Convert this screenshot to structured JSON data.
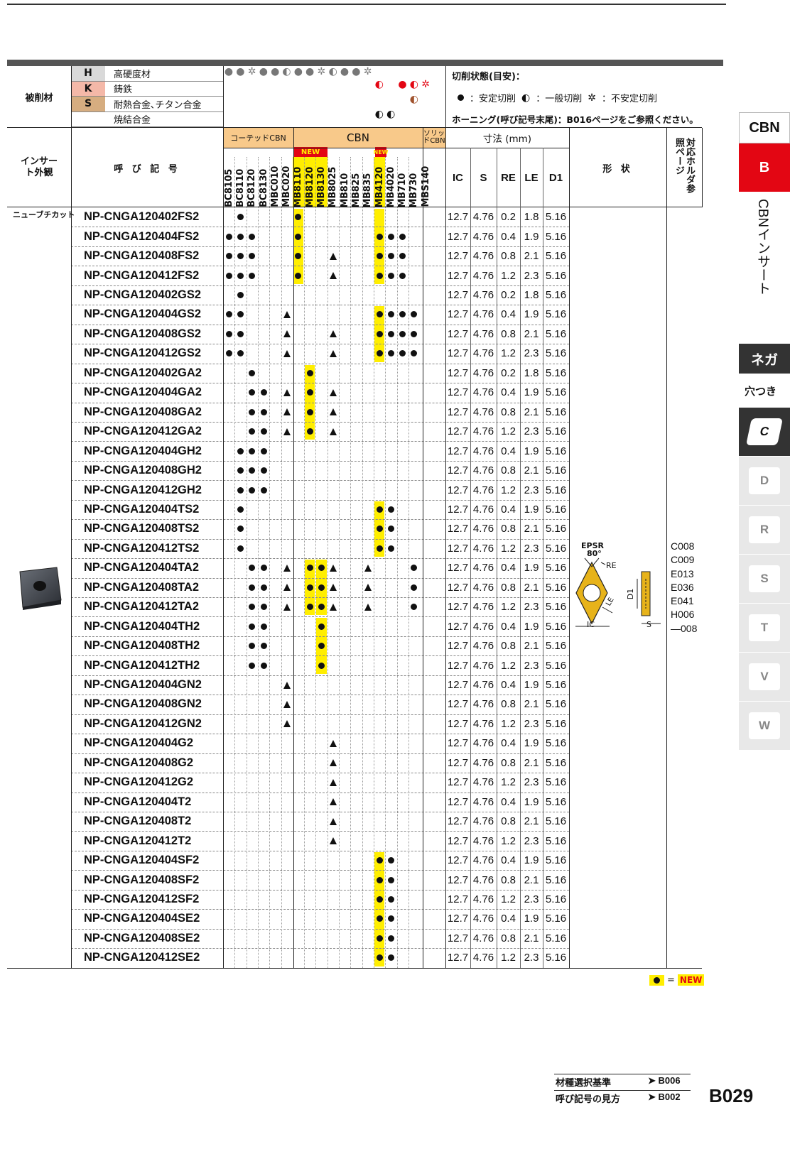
{
  "workpiece": {
    "label": "被削材",
    "rows": [
      {
        "code": "H",
        "name": "高硬度材",
        "color": "#d9d9d9"
      },
      {
        "code": "K",
        "name": "鋳鉄",
        "color": "#f4b8a8"
      },
      {
        "code": "S",
        "name": "耐熱合金､チタン合金",
        "color": "#d6ad80"
      },
      {
        "code": "",
        "name": "焼結合金",
        "color": "#ffffff"
      }
    ]
  },
  "cutting_state": {
    "title": "切削状態(目安)：",
    "stable": "：安定切削",
    "general": "：一般切削",
    "unstable": "：不安定切削",
    "honing": "ホーニング(呼び記号末尾)：B016ページをご参照ください。"
  },
  "header": {
    "insert_appearance": "インサート外観",
    "designation": "呼 び 記 号",
    "coated_cbn": "コーテッドCBN",
    "cbn": "CBN",
    "solid_cbn": "ソリッドCBN",
    "new": "NEW",
    "dimensions": "寸法 (mm)",
    "shape": "形 状",
    "holder_ref": "対応ホルダ参照ページ",
    "dim_cols": [
      "IC",
      "S",
      "RE",
      "LE",
      "D1"
    ]
  },
  "grades": [
    "BC8105",
    "BC8110",
    "BC8120",
    "BC8130",
    "MBC010",
    "MBC020",
    "MB8110",
    "MB8120",
    "MB8130",
    "MB8025",
    "MB810",
    "MB825",
    "MB835",
    "MB4120",
    "MB4020",
    "MB710",
    "MB730",
    "MBS140"
  ],
  "section_label": "ニューブチカット",
  "rows": [
    {
      "code": "NP-CNGA120402FS2",
      "ic": "12.7",
      "s": "4.76",
      "re": "0.2",
      "le": "1.8",
      "d1": "5.16"
    },
    {
      "code": "NP-CNGA120404FS2",
      "ic": "12.7",
      "s": "4.76",
      "re": "0.4",
      "le": "1.9",
      "d1": "5.16"
    },
    {
      "code": "NP-CNGA120408FS2",
      "ic": "12.7",
      "s": "4.76",
      "re": "0.8",
      "le": "2.1",
      "d1": "5.16"
    },
    {
      "code": "NP-CNGA120412FS2",
      "ic": "12.7",
      "s": "4.76",
      "re": "1.2",
      "le": "2.3",
      "d1": "5.16"
    },
    {
      "code": "NP-CNGA120402GS2",
      "ic": "12.7",
      "s": "4.76",
      "re": "0.2",
      "le": "1.8",
      "d1": "5.16"
    },
    {
      "code": "NP-CNGA120404GS2",
      "ic": "12.7",
      "s": "4.76",
      "re": "0.4",
      "le": "1.9",
      "d1": "5.16"
    },
    {
      "code": "NP-CNGA120408GS2",
      "ic": "12.7",
      "s": "4.76",
      "re": "0.8",
      "le": "2.1",
      "d1": "5.16"
    },
    {
      "code": "NP-CNGA120412GS2",
      "ic": "12.7",
      "s": "4.76",
      "re": "1.2",
      "le": "2.3",
      "d1": "5.16"
    },
    {
      "code": "NP-CNGA120402GA2",
      "ic": "12.7",
      "s": "4.76",
      "re": "0.2",
      "le": "1.8",
      "d1": "5.16"
    },
    {
      "code": "NP-CNGA120404GA2",
      "ic": "12.7",
      "s": "4.76",
      "re": "0.4",
      "le": "1.9",
      "d1": "5.16"
    },
    {
      "code": "NP-CNGA120408GA2",
      "ic": "12.7",
      "s": "4.76",
      "re": "0.8",
      "le": "2.1",
      "d1": "5.16"
    },
    {
      "code": "NP-CNGA120412GA2",
      "ic": "12.7",
      "s": "4.76",
      "re": "1.2",
      "le": "2.3",
      "d1": "5.16"
    },
    {
      "code": "NP-CNGA120404GH2",
      "ic": "12.7",
      "s": "4.76",
      "re": "0.4",
      "le": "1.9",
      "d1": "5.16"
    },
    {
      "code": "NP-CNGA120408GH2",
      "ic": "12.7",
      "s": "4.76",
      "re": "0.8",
      "le": "2.1",
      "d1": "5.16"
    },
    {
      "code": "NP-CNGA120412GH2",
      "ic": "12.7",
      "s": "4.76",
      "re": "1.2",
      "le": "2.3",
      "d1": "5.16"
    },
    {
      "code": "NP-CNGA120404TS2",
      "ic": "12.7",
      "s": "4.76",
      "re": "0.4",
      "le": "1.9",
      "d1": "5.16"
    },
    {
      "code": "NP-CNGA120408TS2",
      "ic": "12.7",
      "s": "4.76",
      "re": "0.8",
      "le": "2.1",
      "d1": "5.16"
    },
    {
      "code": "NP-CNGA120412TS2",
      "ic": "12.7",
      "s": "4.76",
      "re": "1.2",
      "le": "2.3",
      "d1": "5.16"
    },
    {
      "code": "NP-CNGA120404TA2",
      "ic": "12.7",
      "s": "4.76",
      "re": "0.4",
      "le": "1.9",
      "d1": "5.16"
    },
    {
      "code": "NP-CNGA120408TA2",
      "ic": "12.7",
      "s": "4.76",
      "re": "0.8",
      "le": "2.1",
      "d1": "5.16"
    },
    {
      "code": "NP-CNGA120412TA2",
      "ic": "12.7",
      "s": "4.76",
      "re": "1.2",
      "le": "2.3",
      "d1": "5.16"
    },
    {
      "code": "NP-CNGA120404TH2",
      "ic": "12.7",
      "s": "4.76",
      "re": "0.4",
      "le": "1.9",
      "d1": "5.16"
    },
    {
      "code": "NP-CNGA120408TH2",
      "ic": "12.7",
      "s": "4.76",
      "re": "0.8",
      "le": "2.1",
      "d1": "5.16"
    },
    {
      "code": "NP-CNGA120412TH2",
      "ic": "12.7",
      "s": "4.76",
      "re": "1.2",
      "le": "2.3",
      "d1": "5.16"
    },
    {
      "code": "NP-CNGA120404GN2",
      "ic": "12.7",
      "s": "4.76",
      "re": "0.4",
      "le": "1.9",
      "d1": "5.16"
    },
    {
      "code": "NP-CNGA120408GN2",
      "ic": "12.7",
      "s": "4.76",
      "re": "0.8",
      "le": "2.1",
      "d1": "5.16"
    },
    {
      "code": "NP-CNGA120412GN2",
      "ic": "12.7",
      "s": "4.76",
      "re": "1.2",
      "le": "2.3",
      "d1": "5.16"
    },
    {
      "code": "NP-CNGA120404G2",
      "ic": "12.7",
      "s": "4.76",
      "re": "0.4",
      "le": "1.9",
      "d1": "5.16"
    },
    {
      "code": "NP-CNGA120408G2",
      "ic": "12.7",
      "s": "4.76",
      "re": "0.8",
      "le": "2.1",
      "d1": "5.16"
    },
    {
      "code": "NP-CNGA120412G2",
      "ic": "12.7",
      "s": "4.76",
      "re": "1.2",
      "le": "2.3",
      "d1": "5.16"
    },
    {
      "code": "NP-CNGA120404T2",
      "ic": "12.7",
      "s": "4.76",
      "re": "0.4",
      "le": "1.9",
      "d1": "5.16"
    },
    {
      "code": "NP-CNGA120408T2",
      "ic": "12.7",
      "s": "4.76",
      "re": "0.8",
      "le": "2.1",
      "d1": "5.16"
    },
    {
      "code": "NP-CNGA120412T2",
      "ic": "12.7",
      "s": "4.76",
      "re": "1.2",
      "le": "2.3",
      "d1": "5.16"
    },
    {
      "code": "NP-CNGA120404SF2",
      "ic": "12.7",
      "s": "4.76",
      "re": "0.4",
      "le": "1.9",
      "d1": "5.16"
    },
    {
      "code": "NP-CNGA120408SF2",
      "ic": "12.7",
      "s": "4.76",
      "re": "0.8",
      "le": "2.1",
      "d1": "5.16"
    },
    {
      "code": "NP-CNGA120412SF2",
      "ic": "12.7",
      "s": "4.76",
      "re": "1.2",
      "le": "2.3",
      "d1": "5.16"
    },
    {
      "code": "NP-CNGA120404SE2",
      "ic": "12.7",
      "s": "4.76",
      "re": "0.4",
      "le": "1.9",
      "d1": "5.16"
    },
    {
      "code": "NP-CNGA120408SE2",
      "ic": "12.7",
      "s": "4.76",
      "re": "0.8",
      "le": "2.1",
      "d1": "5.16"
    },
    {
      "code": "NP-CNGA120412SE2",
      "ic": "12.7",
      "s": "4.76",
      "re": "1.2",
      "le": "2.3",
      "d1": "5.16"
    }
  ],
  "shape_labels": {
    "epsr": "EPSR",
    "angle": "80°",
    "re": "RE",
    "le": "LE",
    "ic": "IC",
    "d1": "D1",
    "s": "S"
  },
  "holder_pages": [
    "C008",
    "C009",
    "E013",
    "E036",
    "E041",
    "H006",
    "—008"
  ],
  "legend": {
    "equals": "=",
    "new": "NEW"
  },
  "footer": {
    "links": [
      {
        "label": "材種選択基準",
        "page": "➤ B006"
      },
      {
        "label": "呼び記号の見方",
        "page": "➤ B002"
      }
    ],
    "page_number": "B029"
  },
  "side_tabs": {
    "cbn": "CBN",
    "b": "B",
    "b_desc": "CBNインサート",
    "nega": "ネガ",
    "with_hole": "穴つき",
    "shapes": [
      "C",
      "D",
      "R",
      "S",
      "T",
      "V",
      "W"
    ]
  },
  "colors": {
    "new_yellow": "#ffee00",
    "cbn_red": "#e30613",
    "header_orange": "#f8c98a",
    "dark": "#333333"
  }
}
